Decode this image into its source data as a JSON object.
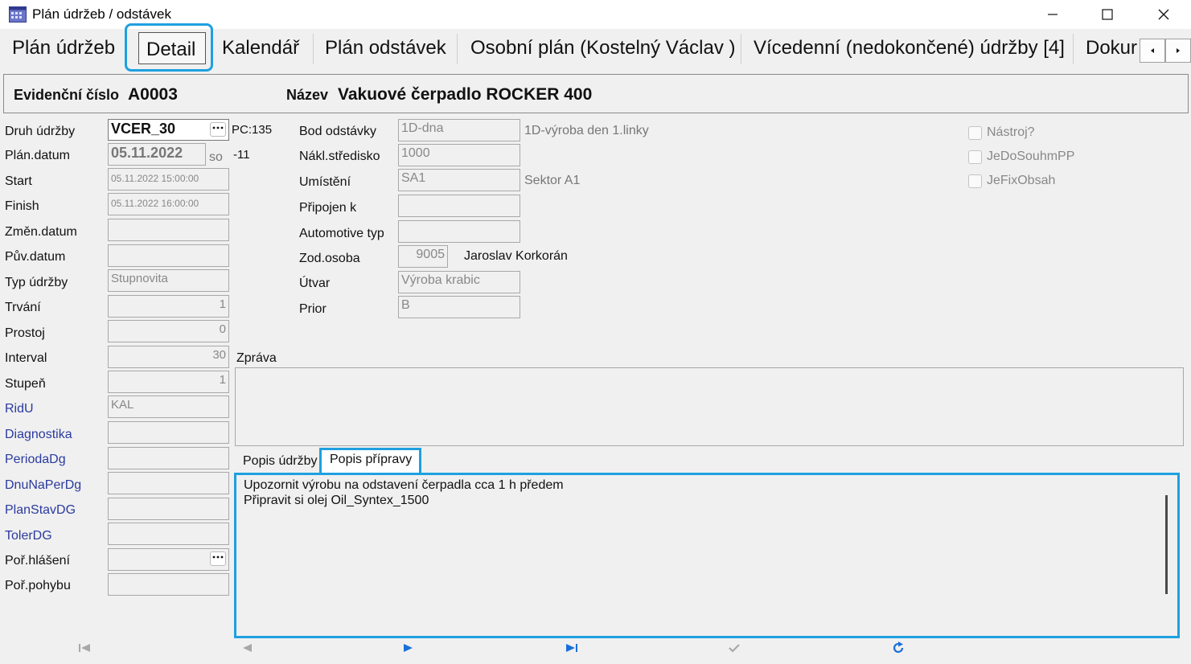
{
  "window": {
    "title": "Plán údržeb / odstávek",
    "controls": [
      "minimize",
      "maximize",
      "close"
    ]
  },
  "tabs": [
    {
      "label": "Plán údržeb"
    },
    {
      "label": "Detail",
      "active": true
    },
    {
      "label": "Kalendář"
    },
    {
      "label": "Plán odstávek"
    },
    {
      "label": "Osobní plán (Kostelný Václav )"
    },
    {
      "label": "Vícedenní (nedokončené) údržby [4]"
    },
    {
      "label": "Dokur"
    }
  ],
  "header": {
    "evidence_label": "Evidenční číslo",
    "evidence_value": "A0003",
    "name_label": "Název",
    "name_value": "Vakuové čerpadlo ROCKER 400"
  },
  "left_fields": {
    "druh_label": "Druh údržby",
    "druh_value": "VCER_30",
    "druh_extra": "PC:135",
    "plan_label": "Plán.datum",
    "plan_value": "05.11.2022",
    "plan_day": "so",
    "plan_offset": "-11",
    "start_label": "Start",
    "start_value": "05.11.2022 15:00:00",
    "finish_label": "Finish",
    "finish_value": "05.11.2022 16:00:00",
    "zmen_label": "Změn.datum",
    "zmen_value": "",
    "puv_label": "Pův.datum",
    "puv_value": "",
    "typ_label": "Typ údržby",
    "typ_value": "Stupnovita",
    "trvani_label": "Trvání",
    "trvani_value": "1",
    "prostoj_label": "Prostoj",
    "prostoj_value": "0",
    "interval_label": "Interval",
    "interval_value": "30",
    "stupen_label": "Stupeň",
    "stupen_value": "1",
    "ridu_label": "RidU",
    "ridu_value": "KAL",
    "diag_label": "Diagnostika",
    "diag_value": "",
    "perioda_label": "PeriodaDg",
    "perioda_value": "",
    "dnu_label": "DnuNaPerDg",
    "dnu_value": "",
    "planstav_label": "PlanStavDG",
    "planstav_value": "",
    "toler_label": "TolerDG",
    "toler_value": "",
    "porhl_label": "Poř.hlášení",
    "porhl_value": "",
    "porpoh_label": "Poř.pohybu",
    "porpoh_value": ""
  },
  "mid_fields": {
    "bod_label": "Bod odstávky",
    "bod_value": "1D-dna",
    "bod_desc": "1D-výroba den 1.linky",
    "nakl_label": "Nákl.středisko",
    "nakl_value": "1000",
    "umist_label": "Umístění",
    "umist_value": "SA1",
    "umist_desc": "Sektor A1",
    "pripojen_label": "Připojen k",
    "pripojen_value": "",
    "auto_label": "Automotive typ",
    "auto_value": "",
    "zod_label": "Zod.osoba",
    "zod_value": "9005",
    "zod_name": "Jaroslav Korkorán",
    "utvar_label": "Útvar",
    "utvar_value": "Výroba krabic",
    "prior_label": "Prior",
    "prior_value": "B"
  },
  "checkboxes": [
    {
      "label": "Nástroj?",
      "checked": false
    },
    {
      "label": "JeDoSouhmPP",
      "checked": false
    },
    {
      "label": "JeFixObsah",
      "checked": false
    }
  ],
  "zprava": {
    "label": "Zpráva",
    "value": ""
  },
  "desc_tabs": [
    {
      "label": "Popis údržby"
    },
    {
      "label": "Popis přípravy",
      "active": true
    }
  ],
  "description_lines": [
    "Upozornit výrobu na odstavení čerpadla cca 1 h předem",
    "Připravit si olej Oil_Syntex_1500"
  ],
  "navigator": [
    "first-icon",
    "prev-icon",
    "next-icon",
    "last-icon",
    "confirm-icon",
    "refresh-icon"
  ],
  "colors": {
    "highlight": "#1ea0e0",
    "link_label": "#2a3a9e",
    "nav_active": "#1a6fd8"
  }
}
